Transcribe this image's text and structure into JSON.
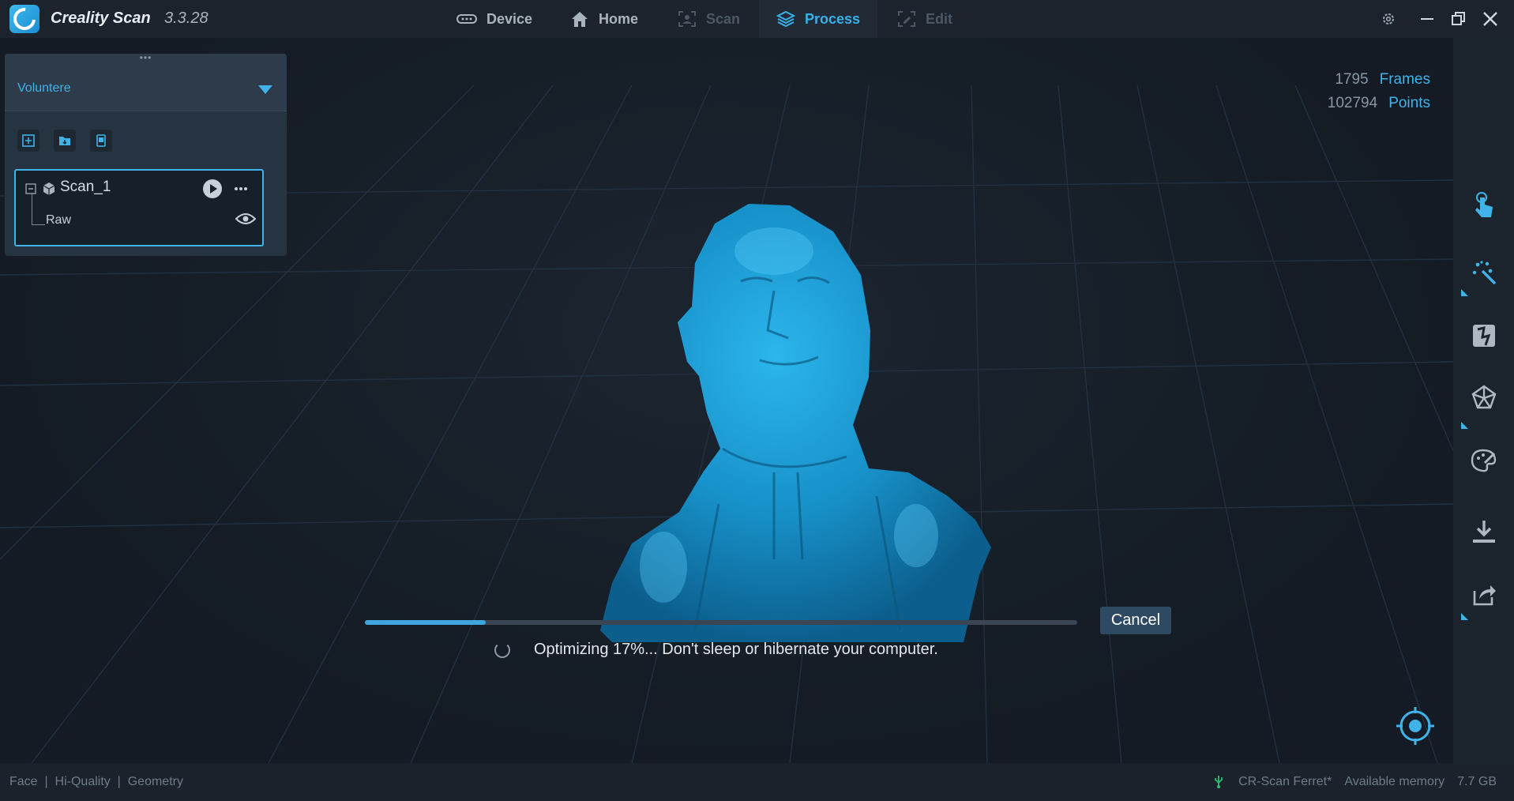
{
  "app": {
    "name": "Creality Scan",
    "version": "3.3.28"
  },
  "tabs": [
    {
      "label": "Device",
      "state": "normal"
    },
    {
      "label": "Home",
      "state": "normal"
    },
    {
      "label": "Scan",
      "state": "disabled"
    },
    {
      "label": "Process",
      "state": "active"
    },
    {
      "label": "Edit",
      "state": "disabled"
    }
  ],
  "project": {
    "name": "Voluntere"
  },
  "scan": {
    "name": "Scan_1",
    "child": "Raw"
  },
  "stats": {
    "frames_value": "1795",
    "frames_label": "Frames",
    "points_value": "102794",
    "points_label": "Points"
  },
  "progress": {
    "percent": 17,
    "message": "Optimizing 17%... Don't sleep or hibernate your computer.",
    "cancel_label": "Cancel"
  },
  "statusbar": {
    "mode": "Face",
    "quality": "Hi-Quality",
    "type": "Geometry",
    "device": "CR-Scan Ferret*",
    "memory_label": "Available memory",
    "memory_value": "7.7 GB"
  },
  "colors": {
    "accent": "#3fb3ea",
    "background": "#151c25",
    "mesh": "#1a9fd8"
  },
  "icons": {
    "right_toolbar": [
      "touch-hand-icon",
      "magic-wand-icon",
      "mesh-fuse-icon",
      "polygon-mesh-icon",
      "texture-palette-icon",
      "export-download-icon",
      "share-icon"
    ]
  }
}
